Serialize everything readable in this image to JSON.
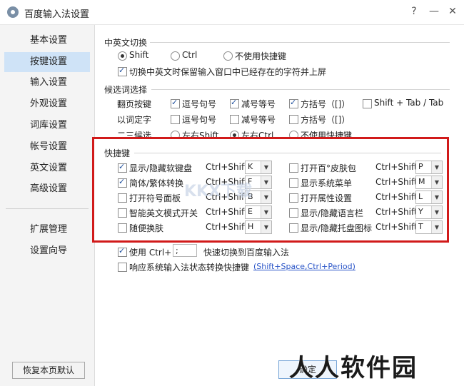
{
  "window": {
    "title": "百度输入法设置",
    "help": "?",
    "minimize": "—",
    "close": "✕"
  },
  "sidebar": {
    "items": [
      {
        "label": "基本设置"
      },
      {
        "label": "按键设置"
      },
      {
        "label": "输入设置"
      },
      {
        "label": "外观设置"
      },
      {
        "label": "词库设置"
      },
      {
        "label": "帐号设置"
      },
      {
        "label": "英文设置"
      },
      {
        "label": "高级设置"
      }
    ],
    "extra_items": [
      {
        "label": "扩展管理"
      },
      {
        "label": "设置向导"
      }
    ],
    "active_index": 1,
    "reset_label": "恢复本页默认"
  },
  "cn_en_switch": {
    "title": "中英文切换",
    "options": [
      "Shift",
      "Ctrl",
      "不使用快捷键"
    ],
    "selected": "Shift",
    "keep_text": {
      "label": "切换中英文时保留输入窗口中已经存在的字符并上屏",
      "checked": true
    }
  },
  "candidate": {
    "title": "候选词选择",
    "rows": [
      {
        "label": "翻页按键",
        "options": [
          {
            "label": "逗号句号",
            "checked": true
          },
          {
            "label": "减号等号",
            "checked": true
          },
          {
            "label": "方括号（[]）",
            "checked": true
          },
          {
            "label": "Shift + Tab / Tab",
            "checked": false
          }
        ]
      },
      {
        "label": "以词定字",
        "options": [
          {
            "label": "逗号句号",
            "checked": false
          },
          {
            "label": "减号等号",
            "checked": false
          },
          {
            "label": "方括号（[]）",
            "checked": false
          }
        ]
      },
      {
        "label": "二三候选",
        "options": [
          {
            "label": "左右Shift",
            "selected": false
          },
          {
            "label": "左右Ctrl",
            "selected": true
          },
          {
            "label": "不使用快捷键",
            "selected": false
          }
        ]
      }
    ]
  },
  "hotkeys": {
    "title": "快捷键",
    "left": [
      {
        "label": "显示/隐藏软键盘",
        "checked": true,
        "mod": "Ctrl+Shift+",
        "key": "K"
      },
      {
        "label": "简体/繁体转换",
        "checked": true,
        "mod": "Ctrl+Shift+",
        "key": "F"
      },
      {
        "label": "打开符号面板",
        "checked": false,
        "mod": "Ctrl+Shift+",
        "key": "B"
      },
      {
        "label": "智能英文模式开关",
        "checked": false,
        "mod": "Ctrl+Shift+",
        "key": "E"
      },
      {
        "label": "随便换肤",
        "checked": false,
        "mod": "Ctrl+Shift+",
        "key": "H"
      }
    ],
    "right": [
      {
        "label": "打开百°皮肤包",
        "checked": false,
        "mod": "Ctrl+Shift+",
        "key": "P"
      },
      {
        "label": "显示系统菜单",
        "checked": false,
        "mod": "Ctrl+Shift+",
        "key": "M"
      },
      {
        "label": "打开属性设置",
        "checked": false,
        "mod": "Ctrl+Shift+",
        "key": "L"
      },
      {
        "label": "显示/隐藏语言栏",
        "checked": false,
        "mod": "Ctrl+Shift+",
        "key": "Y"
      },
      {
        "label": "显示/隐藏托盘图标",
        "checked": false,
        "mod": "Ctrl+Shift+",
        "key": "T"
      }
    ]
  },
  "bottom": {
    "use_ctrl": {
      "label": "使用 Ctrl+",
      "checked": true,
      "value": ";",
      "suffix": "快速切换到百度输入法"
    },
    "respond": {
      "label": "响应系统输入法状态转换快捷键",
      "checked": false,
      "link": "(Shift+Space,Ctrl+Period)"
    },
    "ok_label": "确定"
  },
  "watermark": {
    "text": "人人软件园",
    "center_text": "KKX下载"
  },
  "colors": {
    "highlight_box": "#d11a1a",
    "sidebar_active": "#cfe3f7",
    "link": "#2a55c8"
  }
}
